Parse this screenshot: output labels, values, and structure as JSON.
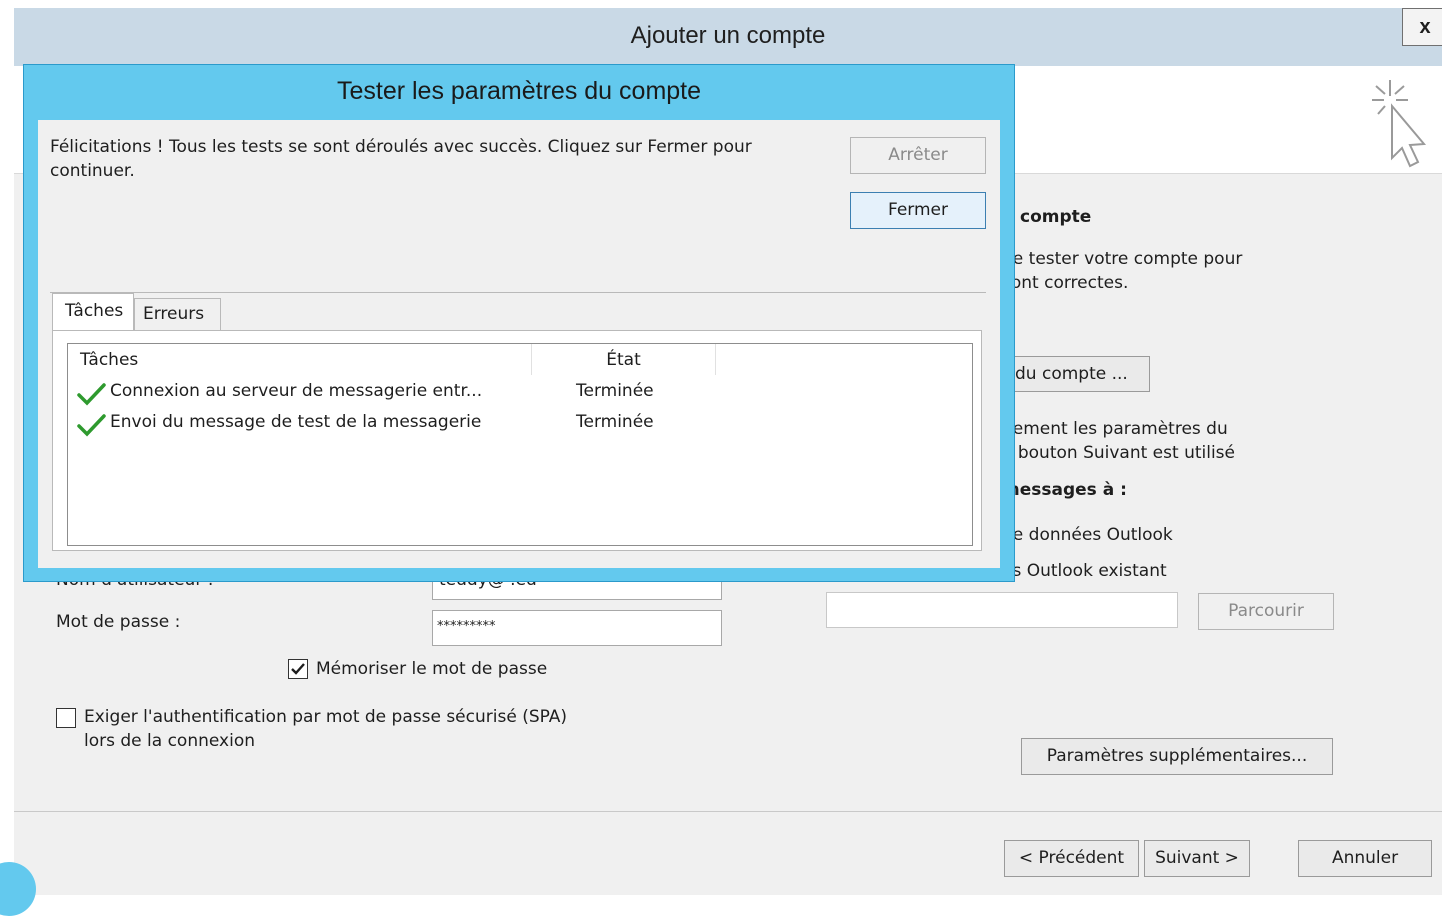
{
  "window": {
    "title": "Ajouter un compte",
    "close_label": "x"
  },
  "background": {
    "section_heading": "u compte",
    "test_text_line1": "de tester votre compte pour",
    "test_text_line2": "sont correctes.",
    "test_button_label": "du compte ...",
    "auto_text_line1": "uement les paramètres du",
    "auto_text_line2": "e bouton Suivant est utilisé",
    "deliver_heading": "messages à :",
    "option_new": "de données Outlook",
    "option_existing": "es Outlook existant",
    "browse_label": "Parcourir",
    "username_label_partial": "Nom d'utilisateur :",
    "username_value": "teddy@          .ed",
    "password_label": "Mot de passe :",
    "password_value": "*********",
    "remember_label": "Mémoriser le mot de passe",
    "remember_checked": true,
    "spa_line1": "Exiger l'authentification par mot de passe sécurisé (SPA)",
    "spa_line2": "lors de la connexion",
    "spa_checked": false,
    "more_settings_label": "Paramètres supplémentaires...",
    "back_label": "< Précédent",
    "next_label": "Suivant >",
    "cancel_label": "Annuler"
  },
  "dialog": {
    "title": "Tester les paramètres du compte",
    "message_line1": "Félicitations ! Tous les tests se sont déroulés avec succès. Cliquez sur Fermer pour",
    "message_line2": "continuer.",
    "stop_label": "Arrêter",
    "close_label": "Fermer",
    "tabs": [
      {
        "label": "Tâches",
        "selected": true
      },
      {
        "label": "Erreurs",
        "selected": false
      }
    ],
    "columns": [
      "Tâches",
      "État"
    ],
    "tasks": [
      {
        "name": "Connexion au serveur de messagerie entr...",
        "status": "Terminée",
        "icon": "check-icon"
      },
      {
        "name": "Envoi du message de test de la messagerie",
        "status": "Terminée",
        "icon": "check-icon"
      }
    ]
  },
  "colors": {
    "dialog_frame": "#63c9ee",
    "titlebar": "#c9d9e6",
    "check_green": "#2e9a2e"
  }
}
